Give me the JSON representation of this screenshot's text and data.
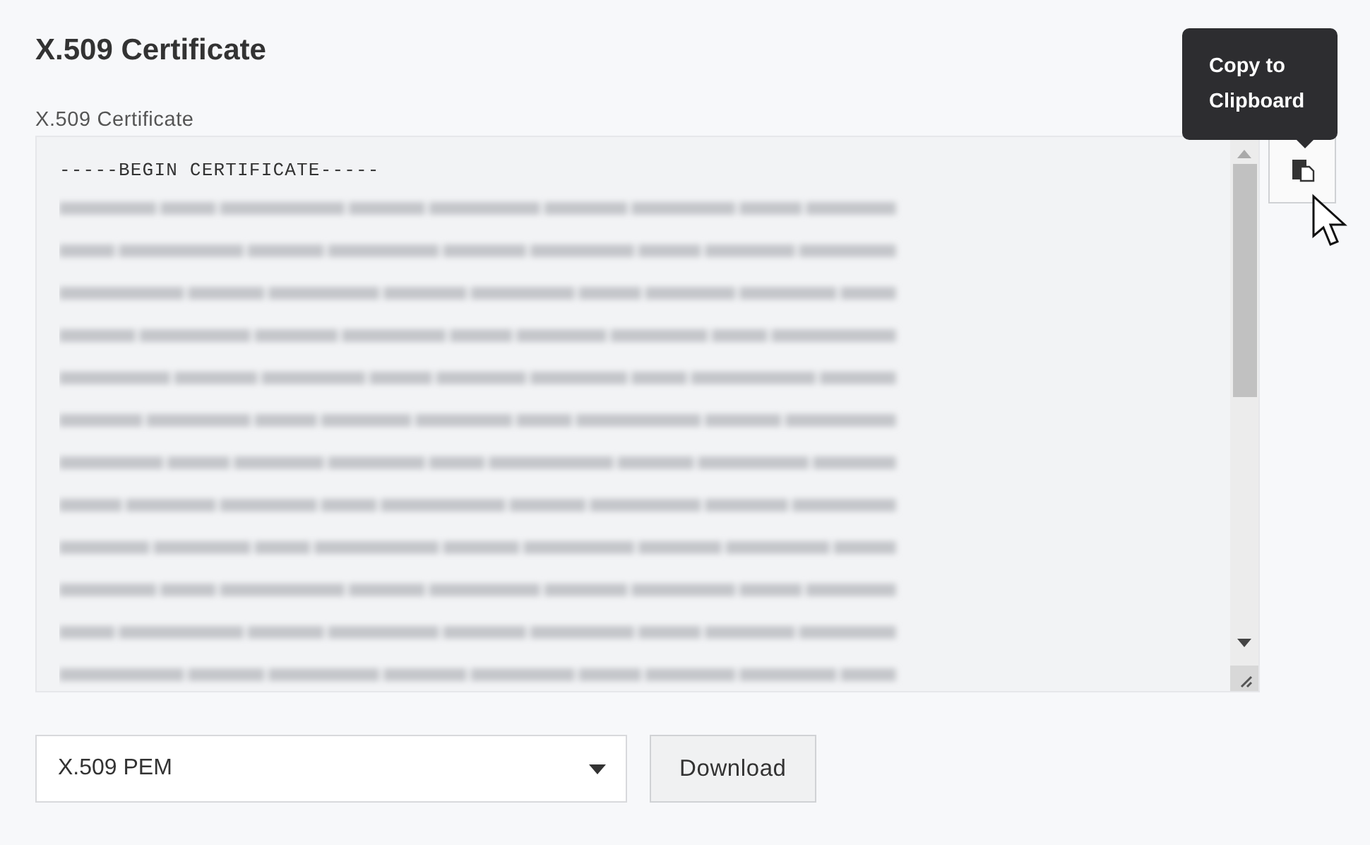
{
  "heading": "X.509 Certificate",
  "field": {
    "label": "X.509 Certificate",
    "first_line": "-----BEGIN CERTIFICATE-----"
  },
  "copy_button": {
    "tooltip": "Copy to Clipboard"
  },
  "format_select": {
    "value": "X.509 PEM"
  },
  "buttons": [
    "Download"
  ]
}
